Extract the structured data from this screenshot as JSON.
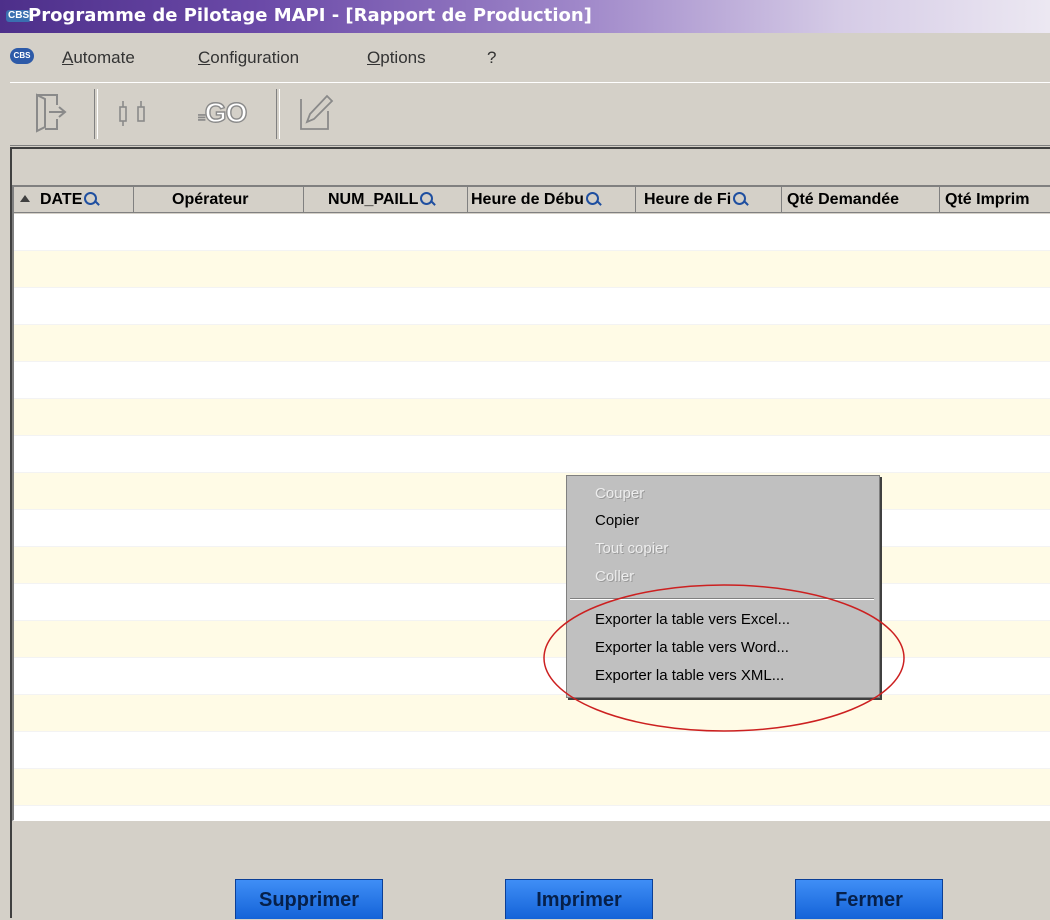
{
  "window": {
    "logo_text": "CBS",
    "title": "Programme de Pilotage MAPI - [Rapport de Production]"
  },
  "menubar": {
    "logo_text": "CBS",
    "items": [
      {
        "underline": "A",
        "rest": "utomate"
      },
      {
        "underline": "C",
        "rest": "onfiguration"
      },
      {
        "underline": "O",
        "rest": "ptions"
      },
      {
        "underline": "",
        "rest": "?"
      }
    ]
  },
  "toolbar": {
    "buttons": [
      {
        "icon": "exit-door-icon"
      },
      {
        "icon": "connect-plugs-icon"
      },
      {
        "icon": "go-icon",
        "label": "GO"
      },
      {
        "icon": "edit-pencil-icon"
      }
    ]
  },
  "grid": {
    "columns": [
      "DATE",
      "Opérateur",
      "NUM_PAILL",
      "Heure de Débu",
      "Heure de Fi",
      "Qté Demandée",
      "Qté Imprim"
    ],
    "row_count": 0
  },
  "context_menu": {
    "items": [
      {
        "label": "Couper",
        "enabled": false
      },
      {
        "label": "Copier",
        "enabled": true
      },
      {
        "label": "Tout copier",
        "enabled": false
      },
      {
        "label": "Coller",
        "enabled": false
      },
      {
        "label": "Exporter la table vers Excel...",
        "enabled": true
      },
      {
        "label": "Exporter la table vers Word...",
        "enabled": true
      },
      {
        "label": "Exporter la table vers XML...",
        "enabled": true
      }
    ],
    "highlight_color": "#cc2020"
  },
  "buttons": {
    "delete": "Supprimer",
    "print": "Imprimer",
    "close": "Fermer"
  },
  "colors": {
    "title_gradient_start": "#4d2f8a",
    "row_alt": "#fffbe6",
    "button_blue": "#1463d8"
  }
}
